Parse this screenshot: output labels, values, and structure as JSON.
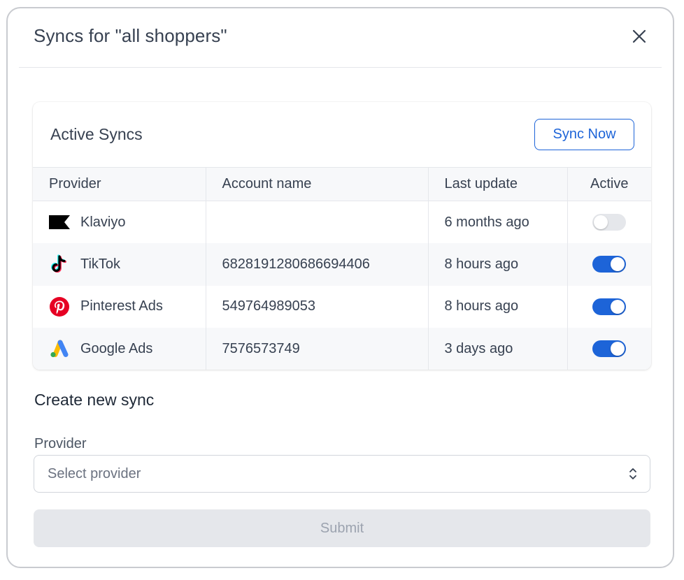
{
  "modal": {
    "title": "Syncs for \"all shoppers\""
  },
  "active_syncs": {
    "title": "Active Syncs",
    "sync_now_label": "Sync Now",
    "columns": {
      "provider": "Provider",
      "account_name": "Account name",
      "last_update": "Last update",
      "active": "Active"
    },
    "rows": [
      {
        "provider": "Klaviyo",
        "icon": "klaviyo-icon",
        "account_name": "",
        "last_update": "6 months ago",
        "active": false
      },
      {
        "provider": "TikTok",
        "icon": "tiktok-icon",
        "account_name": "6828191280686694406",
        "last_update": "8 hours ago",
        "active": true
      },
      {
        "provider": "Pinterest Ads",
        "icon": "pinterest-icon",
        "account_name": "549764989053",
        "last_update": "8 hours ago",
        "active": true
      },
      {
        "provider": "Google Ads",
        "icon": "google-ads-icon",
        "account_name": "7576573749",
        "last_update": "3 days ago",
        "active": true
      }
    ]
  },
  "create_sync": {
    "title": "Create new sync",
    "provider_label": "Provider",
    "provider_placeholder": "Select provider",
    "submit_label": "Submit"
  },
  "colors": {
    "accent": "#1d64d8",
    "toggle_off": "#e5e7eb",
    "pinterest": "#e60023",
    "disabled_bg": "#e5e7eb"
  }
}
